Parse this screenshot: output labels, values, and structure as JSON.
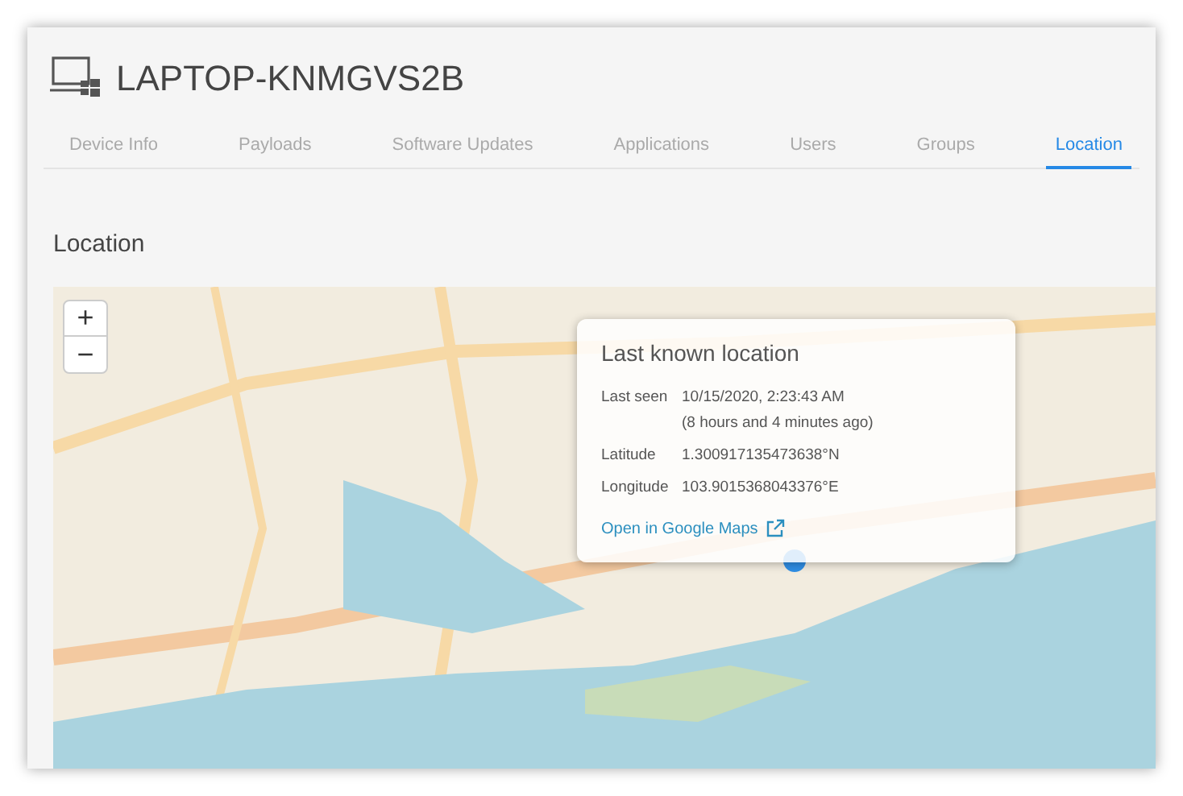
{
  "device": {
    "title": "LAPTOP-KNMGVS2B"
  },
  "tabs": [
    {
      "label": "Device Info",
      "selected": false
    },
    {
      "label": "Payloads",
      "selected": false
    },
    {
      "label": "Software Updates",
      "selected": false
    },
    {
      "label": "Applications",
      "selected": false
    },
    {
      "label": "Users",
      "selected": false
    },
    {
      "label": "Groups",
      "selected": false
    },
    {
      "label": "Location",
      "selected": true
    }
  ],
  "section_title": "Location",
  "map": {
    "zoom_in": "+",
    "zoom_out": "−",
    "popup": {
      "title": "Last known location",
      "rows": [
        {
          "label": "Last seen",
          "value": "10/15/2020, 2:23:43 AM",
          "note": "(8 hours and 4 minutes ago)"
        },
        {
          "label": "Latitude",
          "value": "1.300917135473638°N"
        },
        {
          "label": "Longitude",
          "value": "103.9015368043376°E"
        }
      ],
      "link": "Open in Google Maps"
    }
  }
}
